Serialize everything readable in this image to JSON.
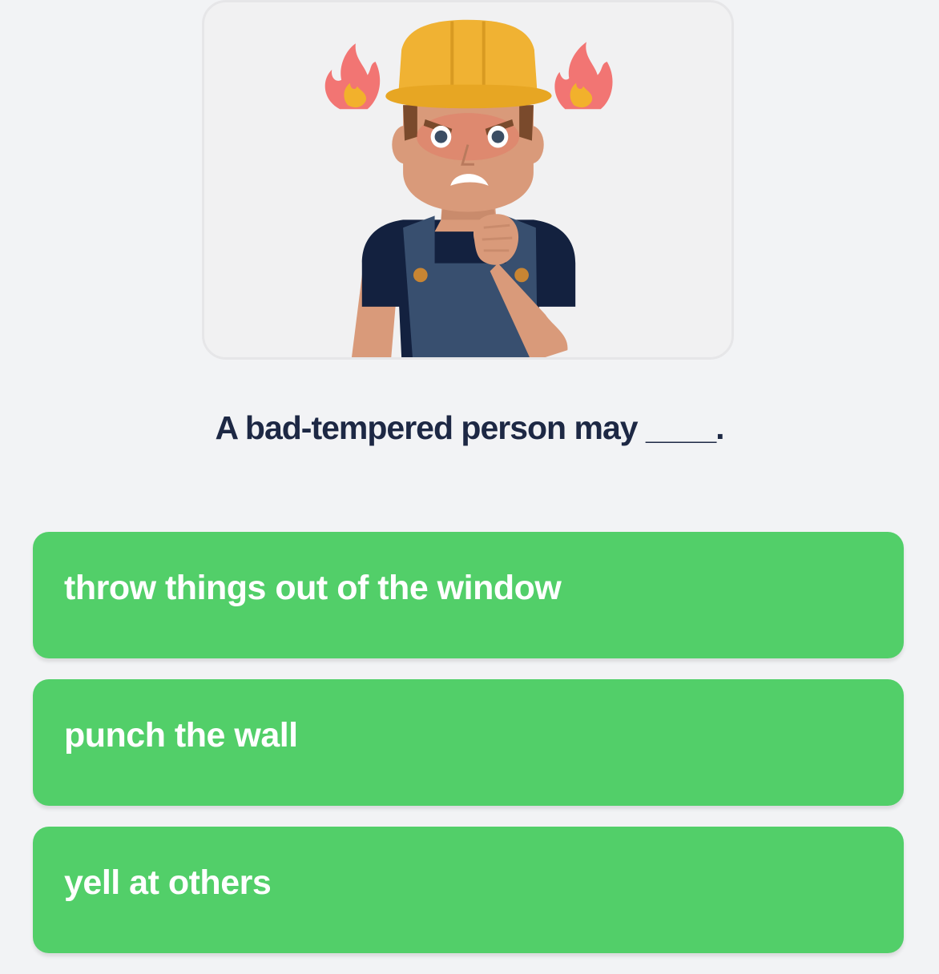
{
  "question": {
    "text": "A bad-tempered person may ____."
  },
  "illustration": {
    "icon": "angry-construction-worker-icon",
    "flame_icon": "flame-icon"
  },
  "answers": [
    {
      "label": "throw things out of the window"
    },
    {
      "label": "punch the wall"
    },
    {
      "label": "yell at others"
    }
  ],
  "colors": {
    "background": "#f2f3f5",
    "answer_button": "#52cf69",
    "question_text": "#1d2844",
    "answer_text": "#ffffff"
  }
}
